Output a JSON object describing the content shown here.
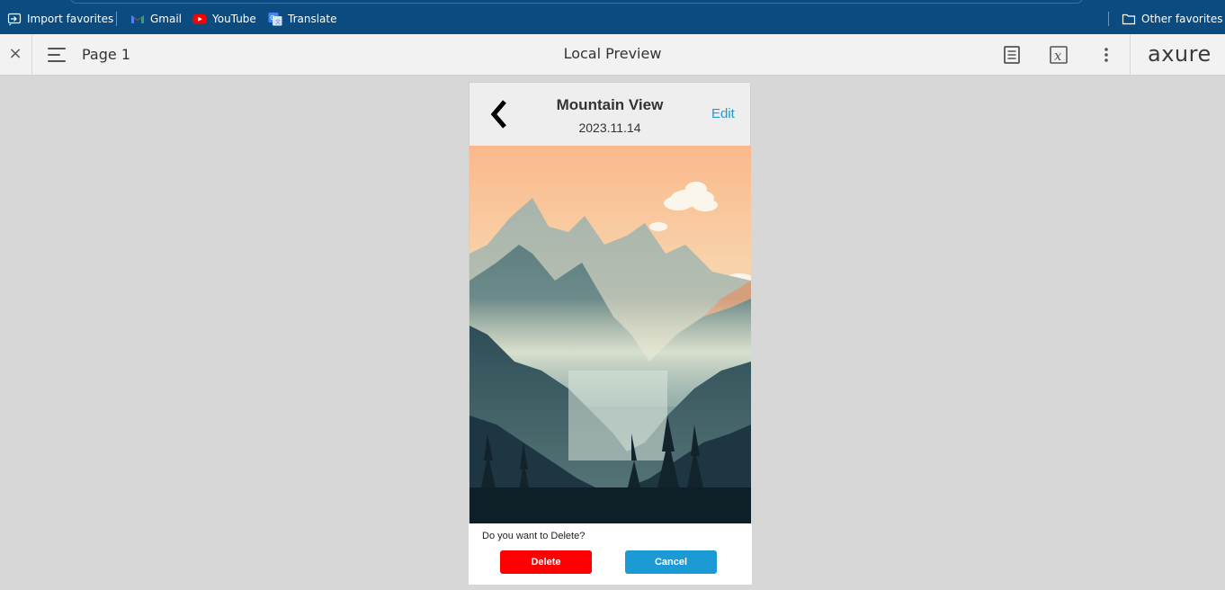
{
  "favorites_bar": {
    "items": [
      {
        "label": "Import favorites",
        "icon": "import-icon"
      },
      {
        "label": "Gmail",
        "icon": "gmail-icon"
      },
      {
        "label": "YouTube",
        "icon": "youtube-icon"
      },
      {
        "label": "Translate",
        "icon": "translate-icon"
      }
    ],
    "other": {
      "label": "Other favorites",
      "icon": "folder-icon"
    }
  },
  "toolbar": {
    "close_icon": "×",
    "page_label": "Page 1",
    "title": "Local Preview",
    "logo": "axure",
    "icons": [
      "notes-icon",
      "variables-icon",
      "more-icon"
    ]
  },
  "prototype": {
    "header": {
      "title": "Mountain View",
      "date": "2023.11.14",
      "edit_label": "Edit",
      "back_icon": "chevron-left-icon"
    },
    "image": {
      "subject": "mountain-landscape-illustration"
    },
    "dialog": {
      "message": "Do you want to Delete?",
      "delete_label": "Delete",
      "cancel_label": "Cancel"
    }
  },
  "colors": {
    "browser_bar": "#0b4b80",
    "toolbar": "#f2f2f2",
    "canvas": "#d7d7d7",
    "accent": "#1c9ad6",
    "danger": "#ff0000"
  }
}
